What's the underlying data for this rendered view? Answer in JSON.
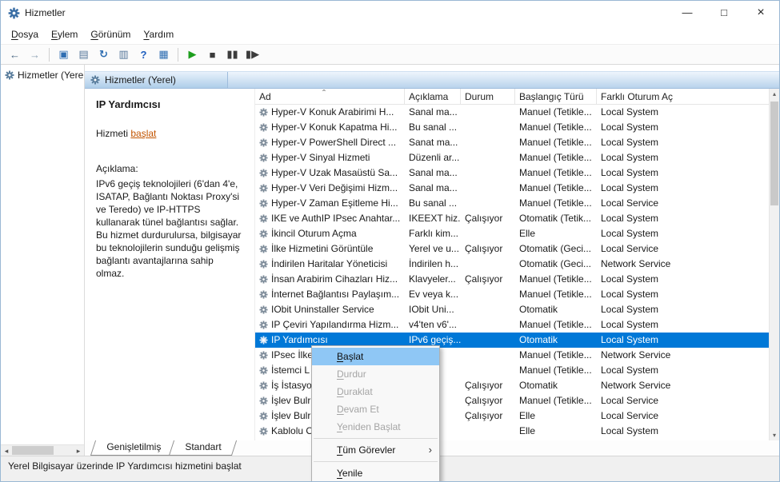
{
  "colors": {
    "selection": "#0078d7",
    "menu-highlight": "#8fc7f5",
    "link": "#c25400"
  },
  "window": {
    "title": "Hizmetler",
    "minimize_glyph": "—",
    "maximize_glyph": "□",
    "close_glyph": "×"
  },
  "menu": {
    "items": [
      "Dosya",
      "Eylem",
      "Görünüm",
      "Yardım"
    ]
  },
  "toolbar": {
    "buttons": [
      {
        "name": "back-button",
        "glyph": "←",
        "color": "#44637f"
      },
      {
        "name": "forward-button",
        "glyph": "→",
        "color": "#8fa3b5"
      },
      {
        "type": "sep"
      },
      {
        "name": "show-console-tree-button",
        "glyph": "▣",
        "color": "#2f6eb2"
      },
      {
        "name": "properties-button",
        "glyph": "▤",
        "color": "#56779a"
      },
      {
        "name": "refresh-button",
        "glyph": "↻",
        "color": "#2f6eb2"
      },
      {
        "name": "export-list-button",
        "glyph": "▥",
        "color": "#56779a"
      },
      {
        "name": "help-button",
        "glyph": "?",
        "color": "#1f5fbf"
      },
      {
        "name": "view-list-button",
        "glyph": "▦",
        "color": "#2f6eb2"
      },
      {
        "type": "sep"
      },
      {
        "name": "start-service-button",
        "glyph": "▶",
        "color": "#1d9e1d"
      },
      {
        "name": "stop-service-button",
        "glyph": "■",
        "color": "#3c3c3c"
      },
      {
        "name": "pause-service-button",
        "glyph": "▮▮",
        "color": "#3c3c3c"
      },
      {
        "name": "restart-service-button",
        "glyph": "▮▶",
        "color": "#3c3c3c"
      }
    ]
  },
  "tree": {
    "root": "Hizmetler (Yerel)"
  },
  "header": {
    "title": "Hizmetler (Yerel)"
  },
  "detail": {
    "service_name": "IP Yardımcısı",
    "action_prefix": "Hizmeti ",
    "action_link": "başlat",
    "description_label": "Açıklama:",
    "description": "IPv6 geçiş teknolojileri (6'dan 4'e, ISATAP, Bağlantı Noktası Proxy'si ve Teredo) ve IP-HTTPS kullanarak tünel bağlantısı sağlar. Bu hizmet durdurulursa, bilgisayar bu teknolojilerin sunduğu gelişmiş bağlantı avantajlarına sahip olmaz."
  },
  "table": {
    "sort_glyph": "ˆ",
    "columns": [
      "Ad",
      "Açıklama",
      "Durum",
      "Başlangıç Türü",
      "Farklı Oturum Aç"
    ],
    "rows": [
      {
        "name": "Hyper-V Konuk Arabirimi H...",
        "desc": "Sanal ma...",
        "status": "",
        "startup": "Manuel (Tetikle...",
        "logon": "Local System"
      },
      {
        "name": "Hyper-V Konuk Kapatma Hi...",
        "desc": "Bu sanal ...",
        "status": "",
        "startup": "Manuel (Tetikle...",
        "logon": "Local System"
      },
      {
        "name": "Hyper-V PowerShell Direct ...",
        "desc": "Sanat ma...",
        "status": "",
        "startup": "Manuel (Tetikle...",
        "logon": "Local System"
      },
      {
        "name": "Hyper-V Sinyal Hizmeti",
        "desc": "Düzenli ar...",
        "status": "",
        "startup": "Manuel (Tetikle...",
        "logon": "Local System"
      },
      {
        "name": "Hyper-V Uzak Masaüstü Sa...",
        "desc": "Sanal ma...",
        "status": "",
        "startup": "Manuel (Tetikle...",
        "logon": "Local System"
      },
      {
        "name": "Hyper-V Veri Değişimi Hizm...",
        "desc": "Sanal ma...",
        "status": "",
        "startup": "Manuel (Tetikle...",
        "logon": "Local System"
      },
      {
        "name": "Hyper-V Zaman Eşitleme Hi...",
        "desc": "Bu sanal ...",
        "status": "",
        "startup": "Manuel (Tetikle...",
        "logon": "Local Service"
      },
      {
        "name": "IKE ve AuthIP IPsec Anahtar...",
        "desc": "IKEEXT hiz...",
        "status": "Çalışıyor",
        "startup": "Otomatik (Tetik...",
        "logon": "Local System"
      },
      {
        "name": "İkincil Oturum Açma",
        "desc": "Farklı kim...",
        "status": "",
        "startup": "Elle",
        "logon": "Local System"
      },
      {
        "name": "İlke Hizmetini Görüntüle",
        "desc": "Yerel ve u...",
        "status": "Çalışıyor",
        "startup": "Otomatik (Geci...",
        "logon": "Local Service"
      },
      {
        "name": "İndirilen Haritalar Yöneticisi",
        "desc": "İndirilen h...",
        "status": "",
        "startup": "Otomatik (Geci...",
        "logon": "Network Service"
      },
      {
        "name": "İnsan Arabirim Cihazları Hiz...",
        "desc": "Klavyeler...",
        "status": "Çalışıyor",
        "startup": "Manuel (Tetikle...",
        "logon": "Local System"
      },
      {
        "name": "İnternet Bağlantısı Paylaşım...",
        "desc": "Ev veya k...",
        "status": "",
        "startup": "Manuel (Tetikle...",
        "logon": "Local System"
      },
      {
        "name": "IObit Uninstaller Service",
        "desc": "IObit Uni...",
        "status": "",
        "startup": "Otomatik",
        "logon": "Local System"
      },
      {
        "name": "IP Çeviri Yapılandırma Hizm...",
        "desc": "v4'ten v6'...",
        "status": "",
        "startup": "Manuel (Tetikle...",
        "logon": "Local System"
      },
      {
        "name": "IP Yardımcısı",
        "desc": "IPv6 geçiş...",
        "status": "",
        "startup": "Otomatik",
        "logon": "Local System",
        "selected": true
      },
      {
        "name": "IPsec İlke",
        "desc": "",
        "status": "",
        "startup": "Manuel (Tetikle...",
        "logon": "Network Service"
      },
      {
        "name": "İstemci L",
        "desc": "",
        "status": "",
        "startup": "Manuel (Tetikle...",
        "logon": "Local System"
      },
      {
        "name": "İş İstasyo",
        "desc": "",
        "status": "Çalışıyor",
        "startup": "Otomatik",
        "logon": "Network Service"
      },
      {
        "name": "İşlev Bulr",
        "desc": "",
        "status": "Çalışıyor",
        "startup": "Manuel (Tetikle...",
        "logon": "Local Service"
      },
      {
        "name": "İşlev Bulr",
        "desc": "",
        "status": "Çalışıyor",
        "startup": "Elle",
        "logon": "Local Service"
      },
      {
        "name": "Kablolu O",
        "desc": "",
        "status": "",
        "startup": "Elle",
        "logon": "Local System"
      }
    ]
  },
  "context_menu": {
    "items": [
      {
        "name": "start",
        "label": "Başlat",
        "highlighted": true
      },
      {
        "name": "stop",
        "label": "Durdur",
        "disabled": true
      },
      {
        "name": "pause",
        "label": "Duraklat",
        "disabled": true
      },
      {
        "name": "resume",
        "label": "Devam Et",
        "disabled": true
      },
      {
        "name": "restart",
        "label": "Yeniden Başlat",
        "disabled": true
      },
      {
        "type": "separator"
      },
      {
        "name": "all-tasks",
        "label": "Tüm Görevler",
        "submenu": true
      },
      {
        "type": "separator"
      },
      {
        "name": "refresh",
        "label": "Yenile"
      }
    ]
  },
  "tabs": [
    "Genişletilmiş",
    "Standart"
  ],
  "scrollbar": {
    "up": "▴",
    "down": "▾",
    "left": "◂",
    "right": "▸",
    "submenu_arrow": "›"
  },
  "statusbar": {
    "text": "Yerel Bilgisayar üzerinde IP Yardımcısı hizmetini başlat"
  }
}
